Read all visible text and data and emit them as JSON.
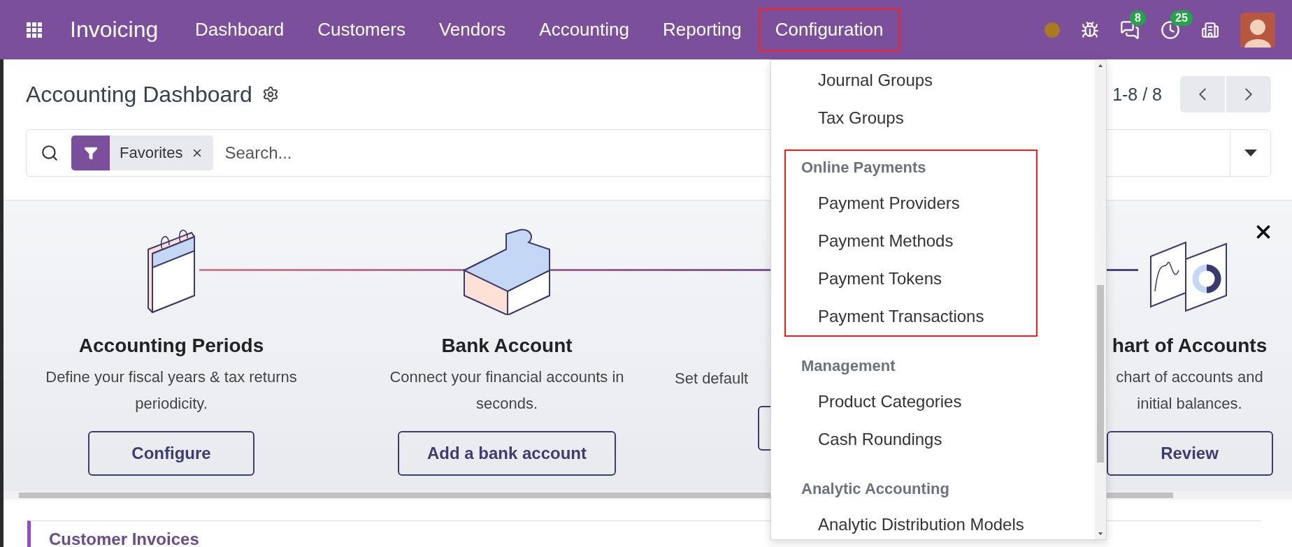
{
  "navbar": {
    "app_name": "Invoicing",
    "menu": [
      {
        "label": "Dashboard",
        "highlighted": false
      },
      {
        "label": "Customers",
        "highlighted": false
      },
      {
        "label": "Vendors",
        "highlighted": false
      },
      {
        "label": "Accounting",
        "highlighted": false
      },
      {
        "label": "Reporting",
        "highlighted": false
      },
      {
        "label": "Configuration",
        "highlighted": true
      }
    ],
    "chat_count": "8",
    "activity_count": "25"
  },
  "control_panel": {
    "title": "Accounting Dashboard",
    "pager": "1-8 / 8",
    "search": {
      "facet": "Favorites",
      "placeholder": "Search..."
    }
  },
  "onboarding": {
    "steps": [
      {
        "kind": "calendar",
        "title": "Accounting Periods",
        "description_lines": [
          "Define your fiscal years & tax returns",
          "periodicity."
        ],
        "button": "Configure"
      },
      {
        "kind": "puzzle",
        "title": "Bank Account",
        "description_lines": [
          "Connect your financial accounts in",
          "seconds."
        ],
        "button": "Add a bank account"
      },
      {
        "kind": "hidden",
        "description_lines": [
          "Set default"
        ],
        "button_partial": true
      },
      {
        "kind": "chart",
        "title": "hart of Accounts",
        "description_lines": [
          "chart of accounts and",
          "initial balances."
        ],
        "button": "Review"
      }
    ]
  },
  "dashboard_card": {
    "title": "Customer Invoices"
  },
  "configuration_menu": {
    "sections": [
      {
        "highlighted": false,
        "items": [
          "Journal Groups",
          "Tax Groups"
        ]
      },
      {
        "header": "Online Payments",
        "highlighted": true,
        "items": [
          "Payment Providers",
          "Payment Methods",
          "Payment Tokens",
          "Payment Transactions"
        ]
      },
      {
        "header": "Management",
        "highlighted": false,
        "items": [
          "Product Categories",
          "Cash Roundings"
        ]
      },
      {
        "header": "Analytic Accounting",
        "highlighted": false,
        "items": [
          "Analytic Distribution Models"
        ]
      }
    ]
  }
}
